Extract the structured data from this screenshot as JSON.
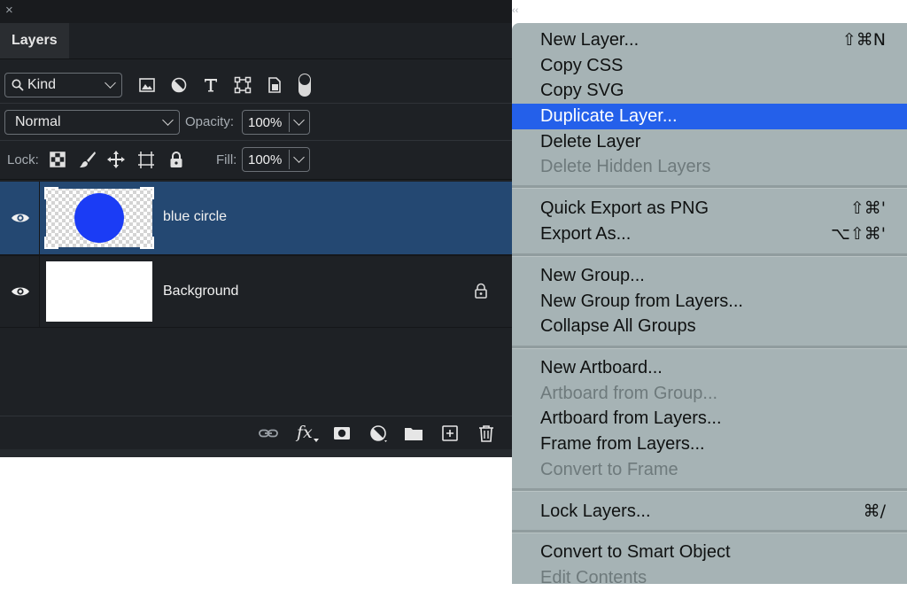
{
  "panel": {
    "tab_label": "Layers",
    "close_glyph": "×",
    "collapse_glyph": "‹‹",
    "filter": {
      "kind_label": "Kind",
      "icons": [
        "image-filter-icon",
        "adjustment-filter-icon",
        "type-filter-icon",
        "shape-filter-icon",
        "smart-object-filter-icon",
        "filter-toggle-icon"
      ]
    },
    "blend_mode": "Normal",
    "opacity_label": "Opacity:",
    "opacity_value": "100%",
    "lock_label": "Lock:",
    "lock_icons": [
      "lock-transparent-pixels-icon",
      "lock-image-pixels-icon",
      "lock-position-icon",
      "lock-artboard-icon",
      "lock-all-icon"
    ],
    "fill_label": "Fill:",
    "fill_value": "100%",
    "layers": [
      {
        "name": "blue circle",
        "selected": true,
        "visible": true,
        "locked": false
      },
      {
        "name": "Background",
        "selected": false,
        "visible": true,
        "locked": true
      }
    ],
    "bottom_icons": [
      "link-layers-icon",
      "fx-icon",
      "layer-mask-icon",
      "adjustment-layer-icon",
      "new-group-icon",
      "new-layer-icon",
      "trash-icon"
    ],
    "fx_label": "fx"
  },
  "menu": {
    "items": [
      {
        "label": "New Layer...",
        "shortcut": "⇧⌘N",
        "disabled": false,
        "highlighted": false
      },
      {
        "label": "Copy CSS",
        "shortcut": "",
        "disabled": false,
        "highlighted": false
      },
      {
        "label": "Copy SVG",
        "shortcut": "",
        "disabled": false,
        "highlighted": false
      },
      {
        "label": "Duplicate Layer...",
        "shortcut": "",
        "disabled": false,
        "highlighted": true
      },
      {
        "label": "Delete Layer",
        "shortcut": "",
        "disabled": false,
        "highlighted": false
      },
      {
        "label": "Delete Hidden Layers",
        "shortcut": "",
        "disabled": true,
        "highlighted": false
      },
      {
        "label": "Quick Export as PNG",
        "shortcut": "⇧⌘'",
        "disabled": false,
        "highlighted": false
      },
      {
        "label": "Export As...",
        "shortcut": "⌥⇧⌘'",
        "disabled": false,
        "highlighted": false
      },
      {
        "label": "New Group...",
        "shortcut": "",
        "disabled": false,
        "highlighted": false
      },
      {
        "label": "New Group from Layers...",
        "shortcut": "",
        "disabled": false,
        "highlighted": false
      },
      {
        "label": "Collapse All Groups",
        "shortcut": "",
        "disabled": false,
        "highlighted": false
      },
      {
        "label": "New Artboard...",
        "shortcut": "",
        "disabled": false,
        "highlighted": false
      },
      {
        "label": "Artboard from Group...",
        "shortcut": "",
        "disabled": true,
        "highlighted": false
      },
      {
        "label": "Artboard from Layers...",
        "shortcut": "",
        "disabled": false,
        "highlighted": false
      },
      {
        "label": "Frame from Layers...",
        "shortcut": "",
        "disabled": false,
        "highlighted": false
      },
      {
        "label": "Convert to Frame",
        "shortcut": "",
        "disabled": true,
        "highlighted": false
      },
      {
        "label": "Lock Layers...",
        "shortcut": "⌘/",
        "disabled": false,
        "highlighted": false
      },
      {
        "label": "Convert to Smart Object",
        "shortcut": "",
        "disabled": false,
        "highlighted": false
      },
      {
        "label": "Edit Contents",
        "shortcut": "",
        "disabled": true,
        "highlighted": false
      }
    ]
  },
  "colors": {
    "panel_bg": "#1e2125",
    "selected_row": "#244872",
    "circle_blue": "#1b3cf5",
    "menu_bg": "#a6b3b5",
    "menu_highlight": "#2460ea"
  }
}
